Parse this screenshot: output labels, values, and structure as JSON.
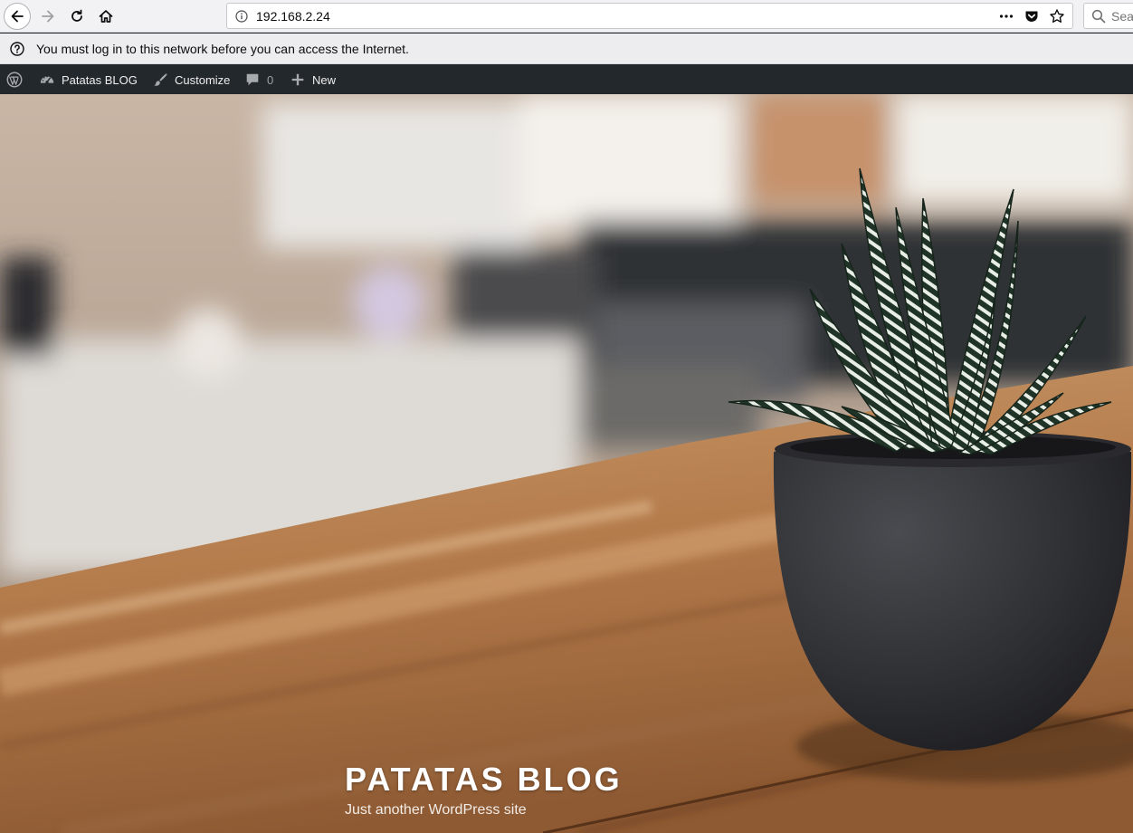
{
  "browser": {
    "url": "192.168.2.24",
    "search_placeholder": "Sea",
    "page_actions_label": "•••"
  },
  "notification": {
    "text": "You must log in to this network before you can access the Internet."
  },
  "admin_bar": {
    "site_name": "Patatas BLOG",
    "customize_label": "Customize",
    "comments_count": "0",
    "new_label": "New"
  },
  "header": {
    "site_title": "PATATAS BLOG",
    "tagline": "Just another WordPress site"
  },
  "colors": {
    "admin_bar_bg": "#23282d",
    "toolbar_bg": "#f2f2f4",
    "notice_bg": "#ededf0"
  }
}
